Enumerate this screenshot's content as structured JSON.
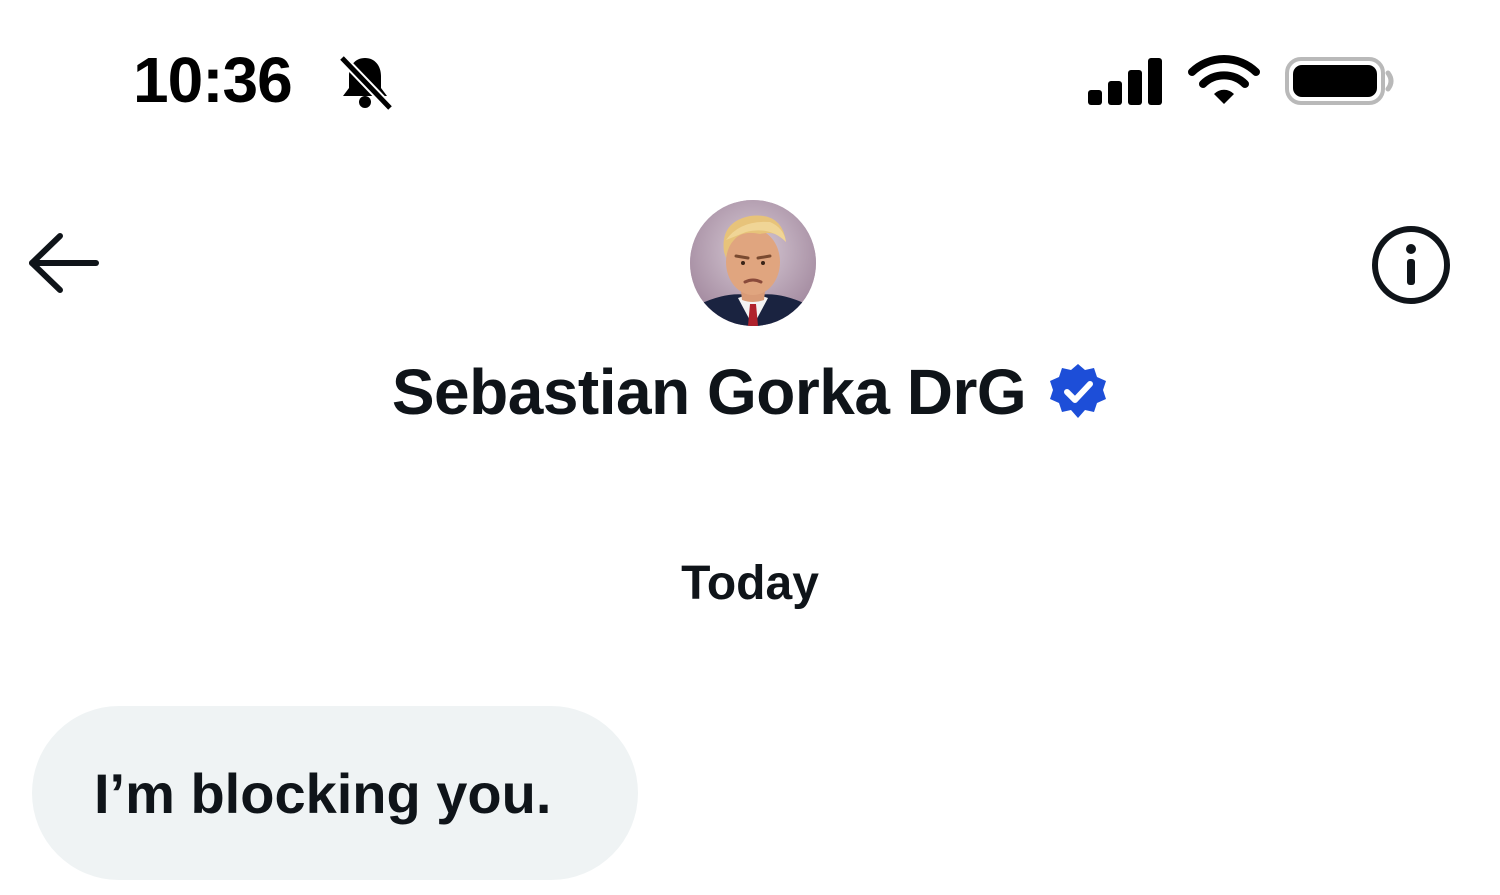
{
  "status_bar": {
    "time": "10:36",
    "icons": [
      "bell-slash-icon",
      "cellular-signal-icon",
      "wifi-icon",
      "battery-icon"
    ]
  },
  "header": {
    "back_icon": "arrow-left-icon",
    "info_icon": "info-circle-icon",
    "contact_name": "Sebastian Gorka DrG",
    "verified_badge_color": "#1d4ed8"
  },
  "conversation": {
    "date_divider": "Today",
    "messages": [
      {
        "direction": "incoming",
        "text": "I’m blocking you."
      }
    ]
  },
  "colors": {
    "text": "#0f1419",
    "bubble_incoming": "#eff3f4",
    "background": "#ffffff"
  }
}
